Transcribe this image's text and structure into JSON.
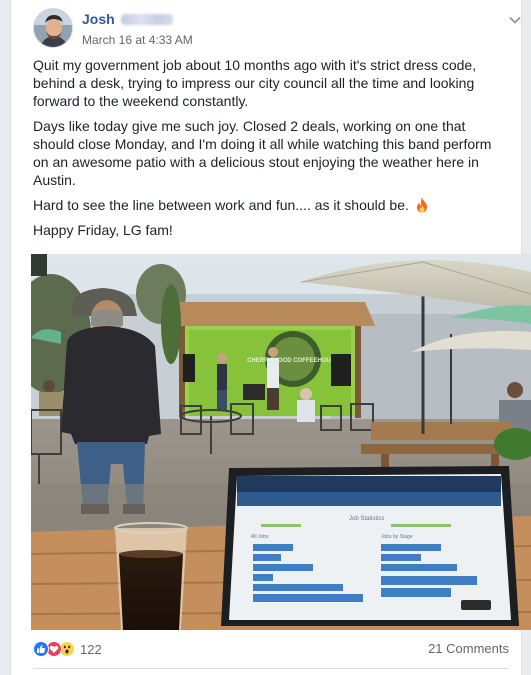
{
  "post": {
    "author_first": "Josh",
    "timestamp": "March 16 at 4:33 AM",
    "menu_icon": "chevron-down-icon",
    "paragraphs": [
      "Quit my government job about 10 months ago with it's strict dress code, behind a desk, trying to impress our city council all the time and looking forward to the weekend constantly.",
      "Days like today give me such joy. Closed 2 deals, working on one that should close Monday, and I'm doing it all while watching this band perform on an awesome patio with a delicious stout enjoying the weather here in Austin.",
      "Hard to see the line between work and fun.... as it should be."
    ],
    "closing": "Happy Friday, LG fam!",
    "emoji_icon": "fire-icon"
  },
  "photo": {
    "stage_sign": "CHERRYWOOD COFFEEHOUSE",
    "laptop_screen_texts": [
      "Job Statistics",
      "All Jobs",
      "Jobs by Stage"
    ]
  },
  "footer": {
    "reaction_icons": [
      "like-icon",
      "love-icon",
      "wow-icon"
    ],
    "reaction_count": "122",
    "comments": "21 Comments"
  },
  "colors": {
    "link_blue": "#365899",
    "like_blue": "#2078f4",
    "love_red": "#f33e58",
    "wow_yellow": "#fcd34a",
    "secondary_text": "#616770"
  }
}
